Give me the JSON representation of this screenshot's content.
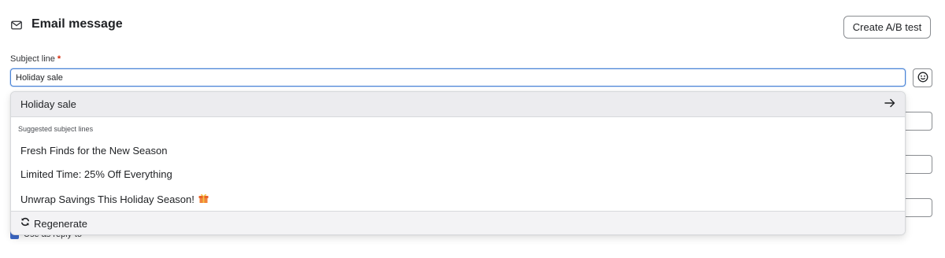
{
  "header": {
    "title": "Email message",
    "icon": "mail-icon",
    "ab_test_label": "Create A/B test"
  },
  "subject": {
    "label": "Subject line",
    "required_mark": "*",
    "value": "Holiday sale"
  },
  "dropdown": {
    "current_value": "Holiday sale",
    "suggestions_header": "Suggested subject lines",
    "suggestions": [
      "Fresh Finds for the New Season",
      "Limited Time: 25% Off Everything",
      "Unwrap Savings This Holiday Season!"
    ],
    "regenerate_label": "Regenerate"
  },
  "background": {
    "reply_to_label": "Use as reply-to"
  },
  "colors": {
    "focus_border": "#4c84d6",
    "required": "#d72c0d",
    "checkbox": "#3d69c7"
  }
}
